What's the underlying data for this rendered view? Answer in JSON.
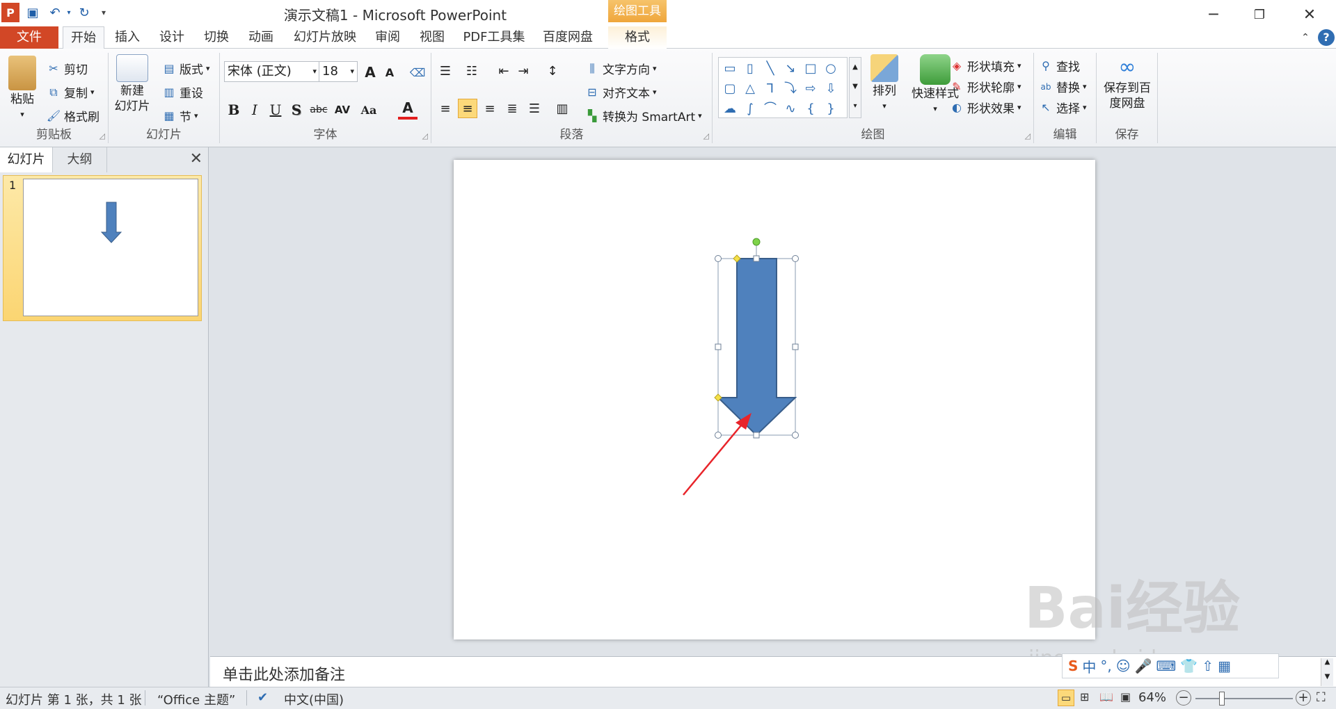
{
  "window": {
    "title": "演示文稿1 - Microsoft PowerPoint",
    "context_tab_group": "绘图工具"
  },
  "tabs": [
    {
      "label": "文件"
    },
    {
      "label": "开始"
    },
    {
      "label": "插入"
    },
    {
      "label": "设计"
    },
    {
      "label": "切换"
    },
    {
      "label": "动画"
    },
    {
      "label": "幻灯片放映"
    },
    {
      "label": "审阅"
    },
    {
      "label": "视图"
    },
    {
      "label": "PDF工具集"
    },
    {
      "label": "百度网盘"
    },
    {
      "label": "格式"
    }
  ],
  "ribbon": {
    "clipboard": {
      "label": "剪贴板",
      "paste": "粘贴",
      "cut": "剪切",
      "copy": "复制",
      "format_painter": "格式刷"
    },
    "slides": {
      "label": "幻灯片",
      "new_slide_1": "新建",
      "new_slide_2": "幻灯片",
      "layout": "版式",
      "reset": "重设",
      "section": "节"
    },
    "font": {
      "label": "字体",
      "font_name": "宋体 (正文)",
      "font_size": "18"
    },
    "paragraph": {
      "label": "段落",
      "text_direction": "文字方向",
      "align_text": "对齐文本",
      "smartart": "转换为 SmartArt"
    },
    "drawing": {
      "label": "绘图",
      "arrange": "排列",
      "quick_styles": "快速样式",
      "shape_fill": "形状填充",
      "shape_outline": "形状轮廓",
      "shape_effects": "形状效果"
    },
    "editing": {
      "label": "编辑",
      "find": "查找",
      "replace": "替换",
      "select": "选择"
    },
    "save": {
      "label": "保存",
      "save_to_1": "保存到百",
      "save_to_2": "度网盘"
    }
  },
  "left_pane": {
    "tab_slides": "幻灯片",
    "tab_outline": "大纲",
    "slide_number": "1"
  },
  "notes": {
    "placeholder": "单击此处添加备注"
  },
  "status": {
    "slide_info": "幻灯片 第 1 张，共 1 张",
    "theme": "“Office 主题”",
    "language": "中文(中国)",
    "zoom": "64%"
  },
  "watermark": {
    "text": "Bai经验",
    "url_text": "jingyan.baidu.com"
  },
  "colors": {
    "arrow_fill": "#4f81bd",
    "arrow_stroke": "#385d8a",
    "file_tab": "#d24726",
    "annotation": "#e8242a"
  }
}
